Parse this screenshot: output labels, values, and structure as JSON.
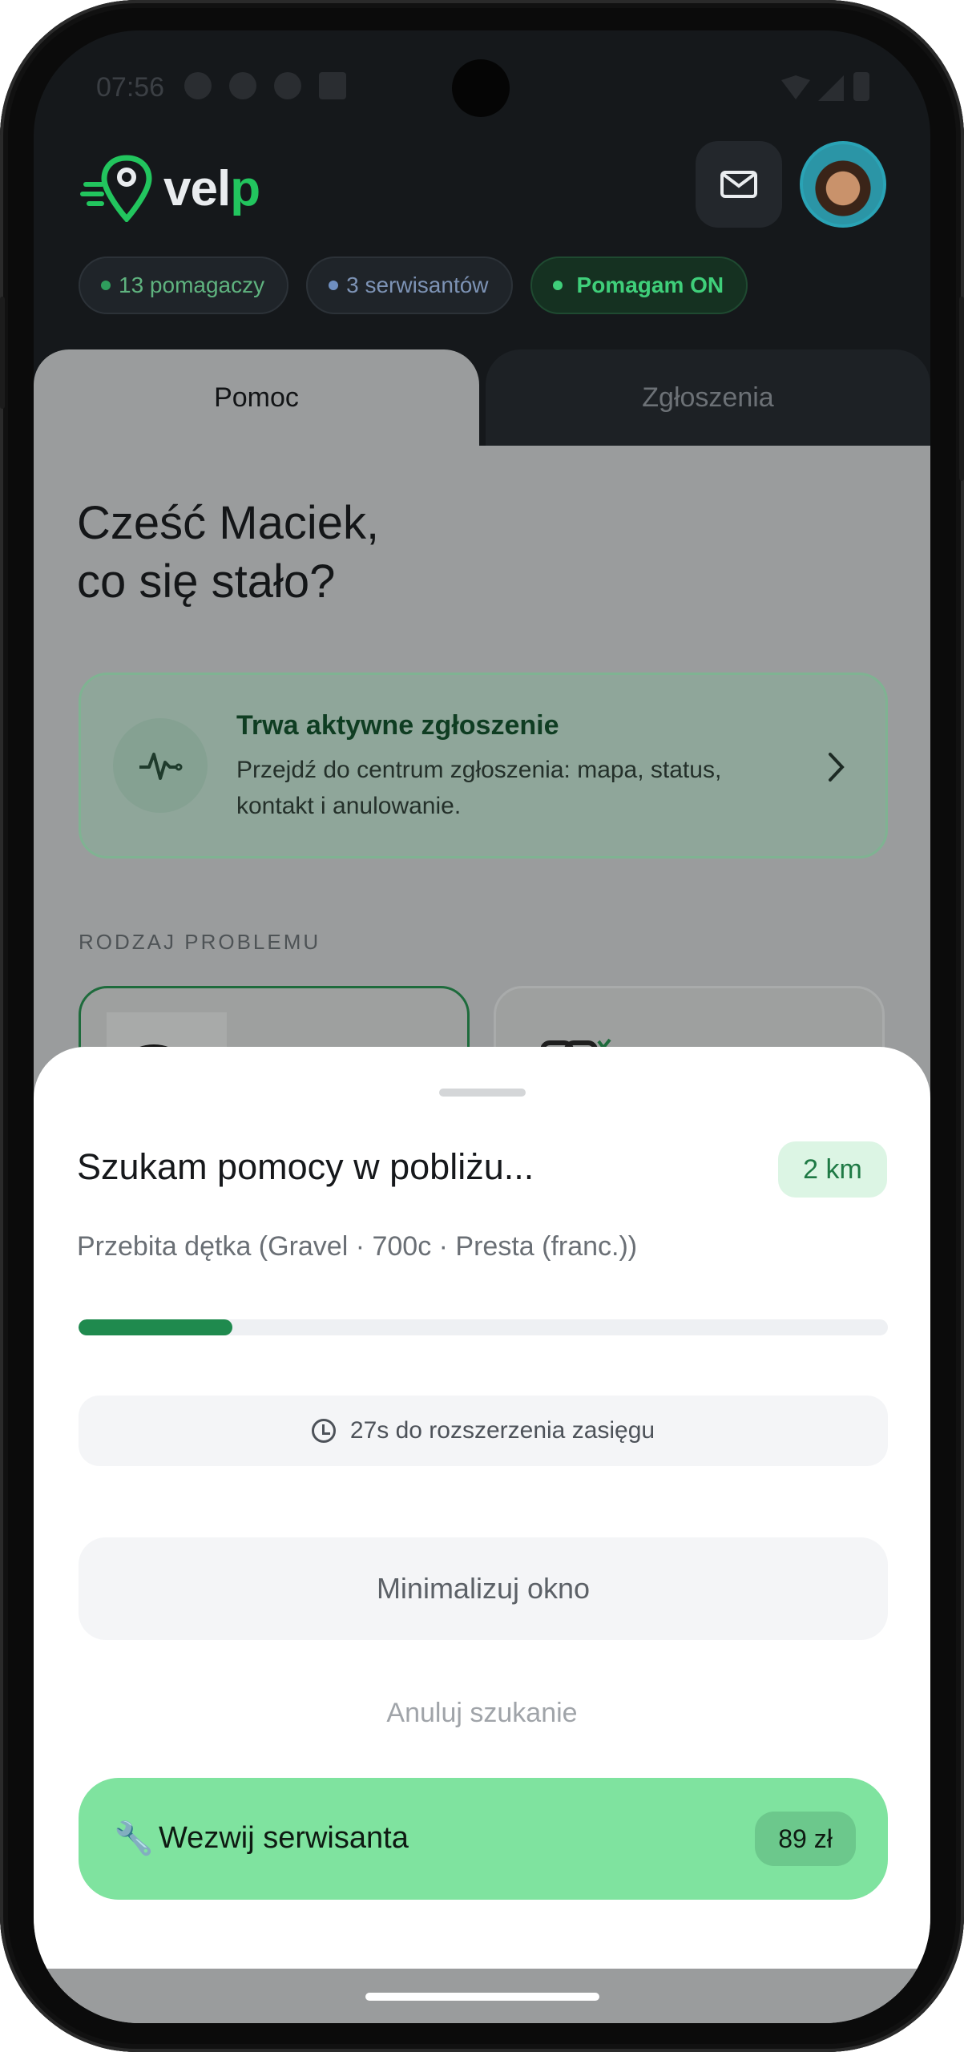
{
  "status_bar": {
    "time": "07:56"
  },
  "header": {
    "logo_text": "vel",
    "logo_text_accent": "p",
    "mail_icon": "mail-icon",
    "avatar_icon": "user-avatar"
  },
  "stats": {
    "helpers": "13 pomagaczy",
    "mechanics": "3 serwisantów",
    "helping_toggle": "Pomagam ON"
  },
  "tabs": [
    {
      "label": "Pomoc",
      "active": true
    },
    {
      "label": "Zgłoszenia",
      "active": false
    }
  ],
  "greeting": {
    "line1": "Cześć Maciek,",
    "line2": "co się stało?"
  },
  "active_request": {
    "title": "Trwa aktywne zgłoszenie",
    "description": "Przejdź do centrum zgłoszenia: mapa, status, kontakt i anulowanie.",
    "icon": "pulse-icon"
  },
  "problem_section": {
    "label": "RODZAJ PROBLEMU"
  },
  "search_sheet": {
    "title": "Szukam pomocy w pobliżu...",
    "radius": "2 km",
    "subtitle": "Przebita dętka (Gravel · 700c · Presta (franc.))",
    "progress": 0.19,
    "timer_text": "27s do rozszerzenia zasięgu",
    "minimize_label": "Minimalizuj okno",
    "cancel_label": "Anuluj szukanie",
    "call_label": "Wezwij serwisanta",
    "call_price": "89 zł"
  },
  "colors": {
    "brand_green": "#22c55e",
    "progress_green": "#1f8a4e",
    "call_button": "#7fe39f"
  }
}
